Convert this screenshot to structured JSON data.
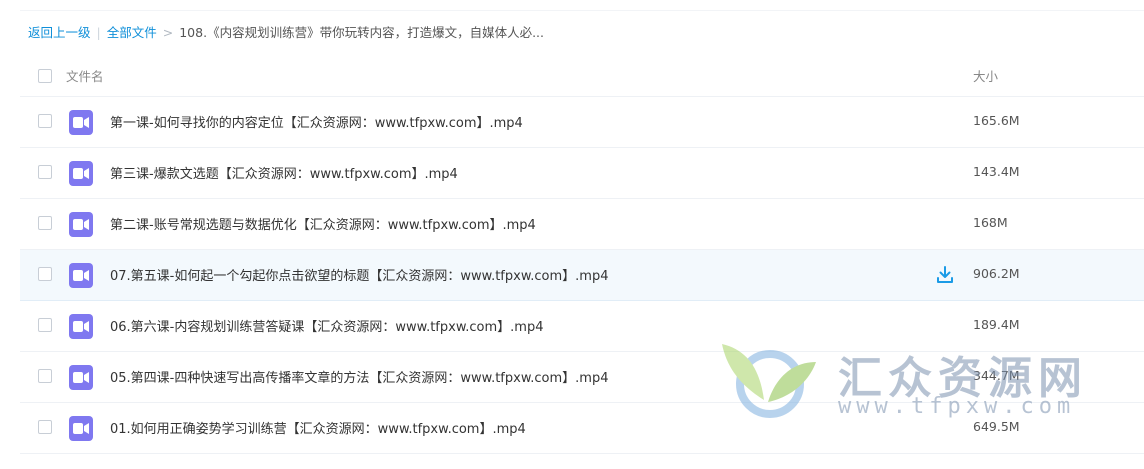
{
  "breadcrumb": {
    "back": "返回上一级",
    "separator": "|",
    "all_files": "全部文件",
    "arrow": ">",
    "current": "108.《内容规划训练营》带你玩转内容，打造爆文，自媒体人必..."
  },
  "table": {
    "columns": {
      "name": "文件名",
      "size": "大小"
    },
    "rows": [
      {
        "name": "第一课-如何寻找你的内容定位【汇众资源网：www.tfpxw.com】.mp4",
        "size": "165.6M",
        "icon": "video-file-icon"
      },
      {
        "name": "第三课-爆款文选题【汇众资源网：www.tfpxw.com】.mp4",
        "size": "143.4M",
        "icon": "video-file-icon"
      },
      {
        "name": "第二课-账号常规选题与数据优化【汇众资源网：www.tfpxw.com】.mp4",
        "size": "168M",
        "icon": "video-file-icon"
      },
      {
        "name": "07.第五课-如何起一个勾起你点击欲望的标题【汇众资源网：www.tfpxw.com】.mp4",
        "size": "906.2M",
        "icon": "video-file-icon",
        "hovered": true
      },
      {
        "name": "06.第六课-内容规划训练营答疑课【汇众资源网：www.tfpxw.com】.mp4",
        "size": "189.4M",
        "icon": "video-file-icon"
      },
      {
        "name": "05.第四课-四种快速写出高传播率文章的方法【汇众资源网：www.tfpxw.com】.mp4",
        "size": "344.7M",
        "icon": "video-file-icon"
      },
      {
        "name": "01.如何用正确姿势学习训练营【汇众资源网：www.tfpxw.com】.mp4",
        "size": "649.5M",
        "icon": "video-file-icon"
      }
    ]
  },
  "watermark": {
    "title": "汇众资源网",
    "url": "www.tfpxw.com"
  },
  "colors": {
    "link": "#0f8fd9",
    "file_icon": "#7f78f0",
    "hover_row": "#f3f9fd",
    "download_icon": "#1a9be6"
  }
}
